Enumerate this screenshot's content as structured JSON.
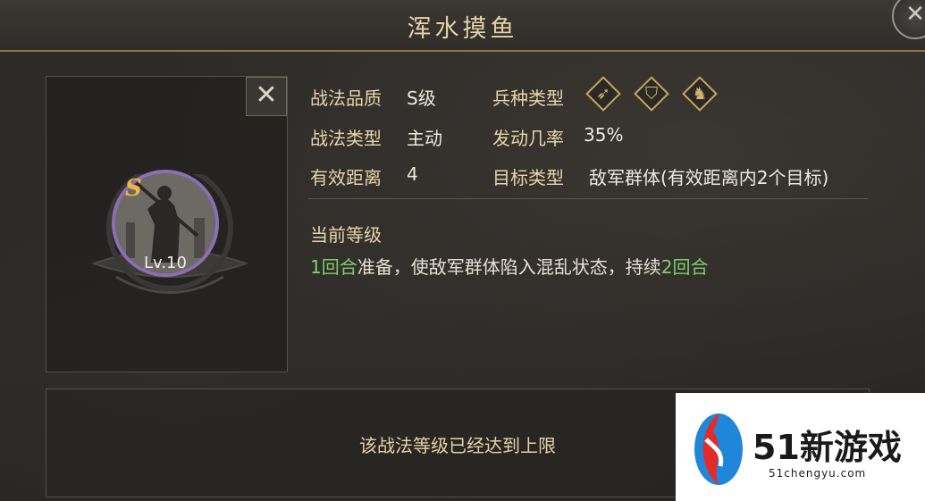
{
  "title": "浑水摸鱼",
  "skill_card": {
    "grade_badge": "S",
    "level": "Lv.10"
  },
  "info": {
    "quality": {
      "label": "战法品质",
      "value": "S级"
    },
    "skill_type": {
      "label": "战法类型",
      "value": "主动"
    },
    "range": {
      "label": "有效距离",
      "value": "4"
    },
    "troop_type": {
      "label": "兵种类型",
      "icons": [
        "bow-icon",
        "shield-icon",
        "horse-icon"
      ]
    },
    "trigger_rate": {
      "label": "发动几率",
      "value": "35%"
    },
    "target_type": {
      "label": "目标类型",
      "value": "敌军群体(有效距离内2个目标)"
    }
  },
  "current_level": {
    "title": "当前等级",
    "desc_parts": [
      "1回合",
      "准备，使敌军群体陷入混乱状态，持续",
      "2回合"
    ]
  },
  "max_level_message": "该战法等级已经达到上限",
  "watermark": {
    "brand": "51新游戏",
    "url": "51chengyu.com"
  },
  "colors": {
    "highlight": "#7dcf6b",
    "label": "#e8d5a8",
    "border_gold": "#8c7448",
    "portrait_ring": "#8a6fb3",
    "grade": "#f0b445"
  },
  "icons": [
    "close-icon",
    "bow-icon",
    "shield-icon",
    "horse-icon",
    "watermark-logo-icon"
  ]
}
